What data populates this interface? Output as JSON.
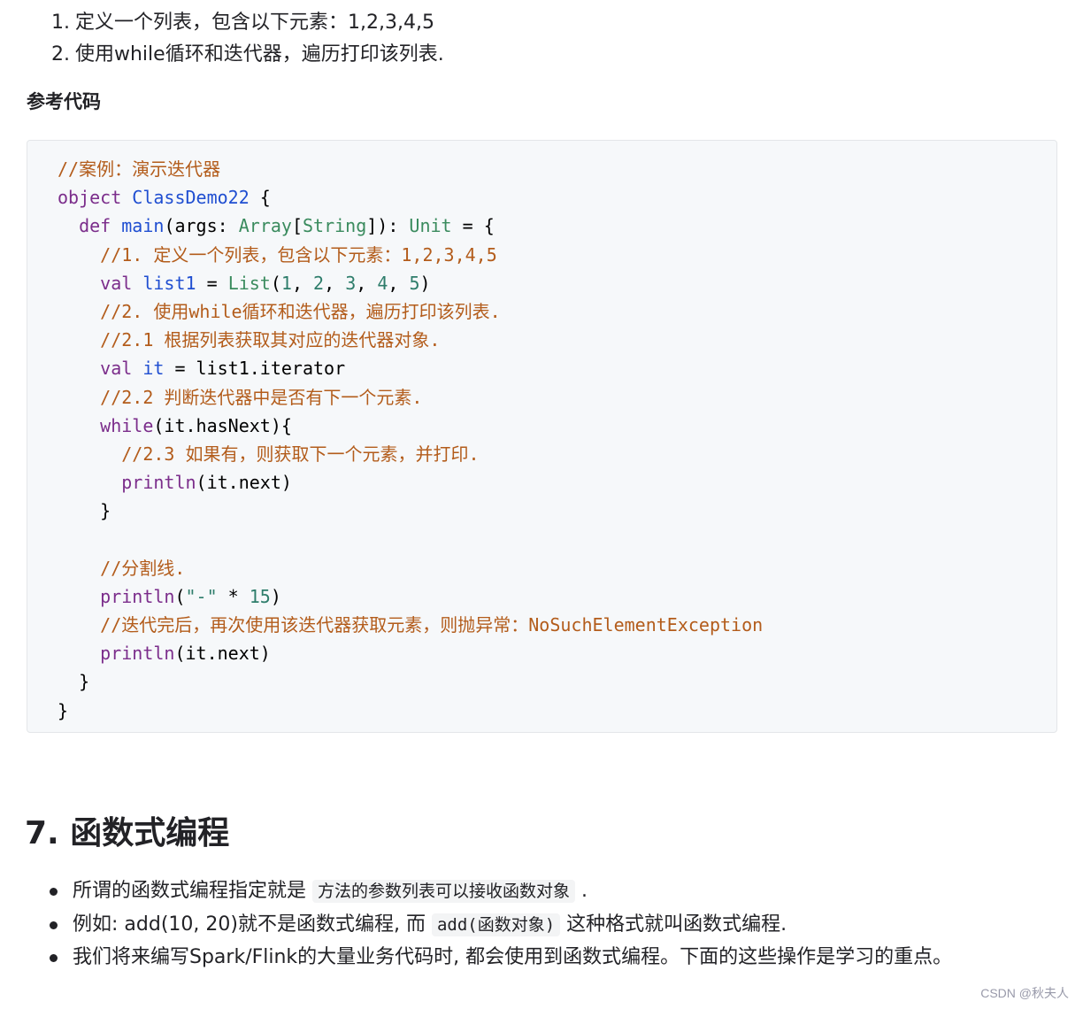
{
  "task_list": {
    "items": [
      {
        "num": "1.",
        "text": "定义一个列表，包含以下元素：1,2,3,4,5"
      },
      {
        "num": "2.",
        "text": "使用while循环和迭代器，遍历打印该列表."
      }
    ]
  },
  "reference_heading": "参考代码",
  "code": {
    "lines": [
      [
        {
          "t": "comment",
          "v": "//案例：演示迭代器"
        }
      ],
      [
        {
          "t": "keyword",
          "v": "object"
        },
        {
          "t": "plain",
          "v": " "
        },
        {
          "t": "title",
          "v": "ClassDemo22"
        },
        {
          "t": "plain",
          "v": " {"
        }
      ],
      [
        {
          "t": "plain",
          "v": "  "
        },
        {
          "t": "keyword",
          "v": "def"
        },
        {
          "t": "plain",
          "v": " "
        },
        {
          "t": "title",
          "v": "main"
        },
        {
          "t": "plain",
          "v": "(args: "
        },
        {
          "t": "type",
          "v": "Array"
        },
        {
          "t": "plain",
          "v": "["
        },
        {
          "t": "type",
          "v": "String"
        },
        {
          "t": "plain",
          "v": "]): "
        },
        {
          "t": "type",
          "v": "Unit"
        },
        {
          "t": "plain",
          "v": " = {"
        }
      ],
      [
        {
          "t": "plain",
          "v": "    "
        },
        {
          "t": "comment",
          "v": "//1. 定义一个列表，包含以下元素：1,2,3,4,5"
        }
      ],
      [
        {
          "t": "plain",
          "v": "    "
        },
        {
          "t": "keyword",
          "v": "val"
        },
        {
          "t": "plain",
          "v": " "
        },
        {
          "t": "title",
          "v": "list1"
        },
        {
          "t": "plain",
          "v": " = "
        },
        {
          "t": "type",
          "v": "List"
        },
        {
          "t": "plain",
          "v": "("
        },
        {
          "t": "number",
          "v": "1"
        },
        {
          "t": "plain",
          "v": ", "
        },
        {
          "t": "number",
          "v": "2"
        },
        {
          "t": "plain",
          "v": ", "
        },
        {
          "t": "number",
          "v": "3"
        },
        {
          "t": "plain",
          "v": ", "
        },
        {
          "t": "number",
          "v": "4"
        },
        {
          "t": "plain",
          "v": ", "
        },
        {
          "t": "number",
          "v": "5"
        },
        {
          "t": "plain",
          "v": ")"
        }
      ],
      [
        {
          "t": "plain",
          "v": "    "
        },
        {
          "t": "comment",
          "v": "//2. 使用while循环和迭代器，遍历打印该列表."
        }
      ],
      [
        {
          "t": "plain",
          "v": "    "
        },
        {
          "t": "comment",
          "v": "//2.1 根据列表获取其对应的迭代器对象."
        }
      ],
      [
        {
          "t": "plain",
          "v": "    "
        },
        {
          "t": "keyword",
          "v": "val"
        },
        {
          "t": "plain",
          "v": " "
        },
        {
          "t": "title",
          "v": "it"
        },
        {
          "t": "plain",
          "v": " = list1.iterator"
        }
      ],
      [
        {
          "t": "plain",
          "v": "    "
        },
        {
          "t": "comment",
          "v": "//2.2 判断迭代器中是否有下一个元素."
        }
      ],
      [
        {
          "t": "plain",
          "v": "    "
        },
        {
          "t": "keyword",
          "v": "while"
        },
        {
          "t": "plain",
          "v": "(it.hasNext){"
        }
      ],
      [
        {
          "t": "plain",
          "v": "      "
        },
        {
          "t": "comment",
          "v": "//2.3 如果有，则获取下一个元素，并打印."
        }
      ],
      [
        {
          "t": "plain",
          "v": "      "
        },
        {
          "t": "builtin",
          "v": "println"
        },
        {
          "t": "plain",
          "v": "(it.next)"
        }
      ],
      [
        {
          "t": "plain",
          "v": "    }"
        }
      ],
      [
        {
          "t": "plain",
          "v": ""
        }
      ],
      [
        {
          "t": "plain",
          "v": "    "
        },
        {
          "t": "comment",
          "v": "//分割线."
        }
      ],
      [
        {
          "t": "plain",
          "v": "    "
        },
        {
          "t": "builtin",
          "v": "println"
        },
        {
          "t": "plain",
          "v": "("
        },
        {
          "t": "string",
          "v": "\"-\""
        },
        {
          "t": "plain",
          "v": " * "
        },
        {
          "t": "number",
          "v": "15"
        },
        {
          "t": "plain",
          "v": ")"
        }
      ],
      [
        {
          "t": "plain",
          "v": "    "
        },
        {
          "t": "comment",
          "v": "//迭代完后，再次使用该迭代器获取元素，则抛异常：NoSuchElementException"
        }
      ],
      [
        {
          "t": "plain",
          "v": "    "
        },
        {
          "t": "builtin",
          "v": "println"
        },
        {
          "t": "plain",
          "v": "(it.next)"
        }
      ],
      [
        {
          "t": "plain",
          "v": "  }"
        }
      ],
      [
        {
          "t": "plain",
          "v": "}"
        }
      ]
    ]
  },
  "section": {
    "title": "7. 函数式编程",
    "bullets": [
      {
        "before": "所谓的函数式编程指定就是 ",
        "code": "方法的参数列表可以接收函数对象",
        "after": " ."
      },
      {
        "before": "例如: add(10, 20)就不是函数式编程, 而 ",
        "code": "add(函数对象)",
        "after": " 这种格式就叫函数式编程."
      },
      {
        "before": "我们将来编写Spark/Flink的大量业务代码时, 都会使用到函数式编程。下面的这些操作是学习的重点。",
        "code": "",
        "after": ""
      }
    ]
  },
  "watermark": "CSDN @秋夫人"
}
